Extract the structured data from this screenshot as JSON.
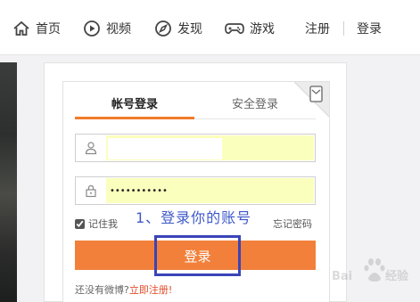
{
  "nav": {
    "items": [
      {
        "label": "首页",
        "icon": "home-icon"
      },
      {
        "label": "视频",
        "icon": "video-icon"
      },
      {
        "label": "发现",
        "icon": "compass-icon"
      },
      {
        "label": "游戏",
        "icon": "gamepad-icon"
      }
    ],
    "register": "注册",
    "login": "登录"
  },
  "login_card": {
    "tabs": [
      {
        "label": "帐号登录",
        "active": true
      },
      {
        "label": "安全登录",
        "active": false
      }
    ],
    "username": {
      "value": "",
      "icon": "user-icon"
    },
    "password": {
      "value": "•••••••••••",
      "icon": "lock-icon"
    },
    "remember_label": "记住我",
    "remember_checked": true,
    "forgot_label": "忘记密码",
    "submit_label": "登录",
    "register_prompt": "还没有微博?",
    "register_link": "立即注册!"
  },
  "annotation": "1、登录你的账号",
  "watermark_text": "Baidu 经验",
  "colors": {
    "accent": "#f27c2a",
    "button": "#f2803a",
    "autofill": "#fbffbd",
    "annotation": "#3f59c9",
    "register_link": "#e24b2a"
  }
}
